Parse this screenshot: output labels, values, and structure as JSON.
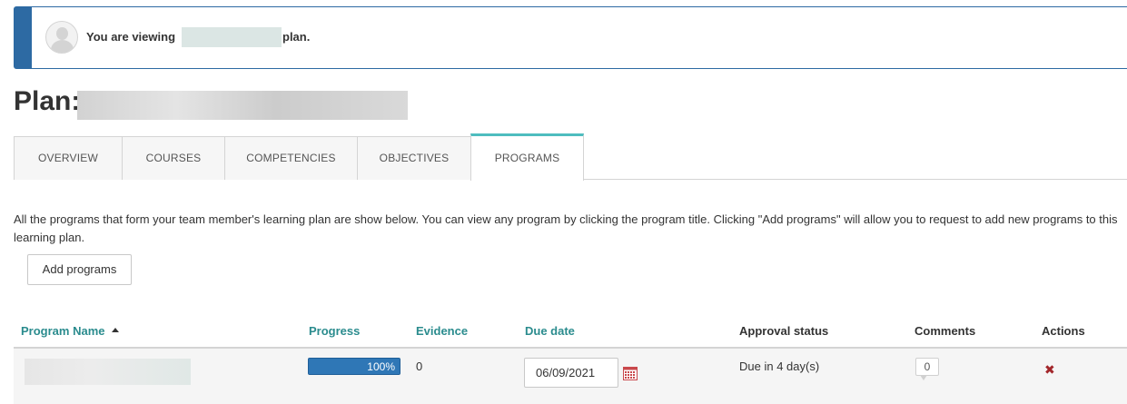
{
  "banner": {
    "message_prefix": "You are viewing",
    "message_suffix": "plan."
  },
  "plan": {
    "title_label": "Plan:"
  },
  "tabs": [
    {
      "label": "OVERVIEW"
    },
    {
      "label": "COURSES"
    },
    {
      "label": "COMPETENCIES"
    },
    {
      "label": "OBJECTIVES"
    },
    {
      "label": "PROGRAMS"
    }
  ],
  "description": "All the programs that form your team member's learning plan are show below. You can view any program by clicking the program title. Clicking \"Add programs\" will allow you to request to add new programs to this learning plan.",
  "add_button_label": "Add programs",
  "table": {
    "headers": {
      "program_name": "Program Name",
      "progress": "Progress",
      "evidence": "Evidence",
      "due_date": "Due date",
      "approval_status": "Approval status",
      "comments": "Comments",
      "actions": "Actions"
    },
    "rows": [
      {
        "progress_label": "100%",
        "progress_value": 1.0,
        "evidence": "0",
        "due_date": "06/09/2021",
        "approval_status": "Due in 4 day(s)",
        "comments": "0"
      }
    ]
  },
  "colors": {
    "brand_blue": "#2d6aa3",
    "active_tab_accent": "#4ebdbf",
    "link_teal": "#2b8c8e",
    "progress_blue": "#2f77b6",
    "delete_red": "#a2262a"
  },
  "icons": {
    "avatar": "user-avatar-icon",
    "sort": "sort-ascending-icon",
    "calendar": "calendar-icon",
    "comment": "comment-bubble-icon",
    "delete": "delete-x-icon"
  }
}
